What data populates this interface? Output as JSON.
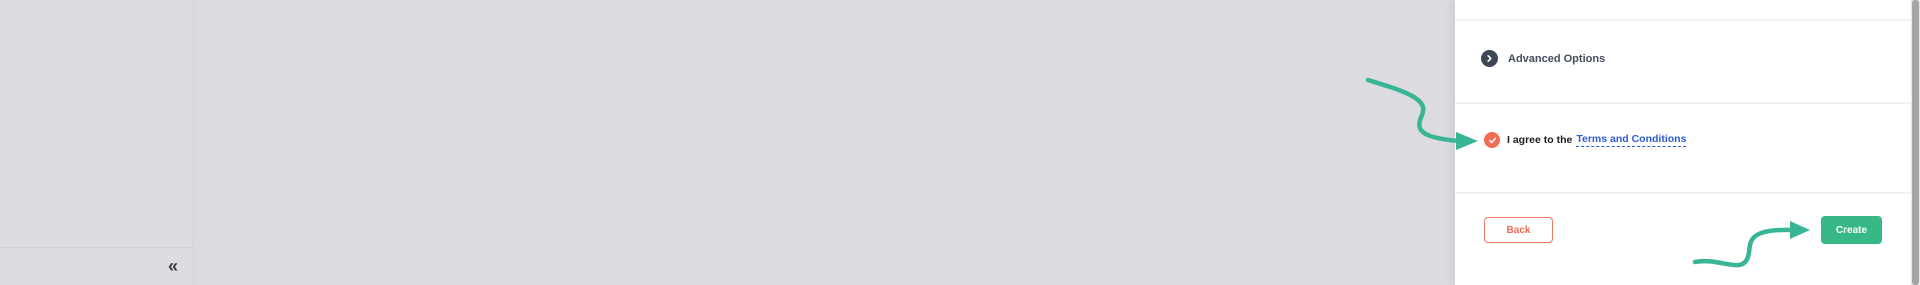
{
  "sidebar": {
    "collapse_icon": "double-chevron-left-icon",
    "collapse_glyph": "«"
  },
  "advanced": {
    "icon": "chevron-right-circle-icon",
    "label": "Advanced Options"
  },
  "terms": {
    "icon": "check-circle-icon",
    "prefix": "I agree to the",
    "link_label": "Terms and Conditions",
    "checked": true
  },
  "actions": {
    "back_label": "Back",
    "create_label": "Create"
  },
  "colors": {
    "accent_green": "#38b787",
    "accent_orange": "#f26b52",
    "link_blue": "#2c5bd6",
    "annotation_teal": "#37b595",
    "dark_icon": "#3e4756"
  }
}
